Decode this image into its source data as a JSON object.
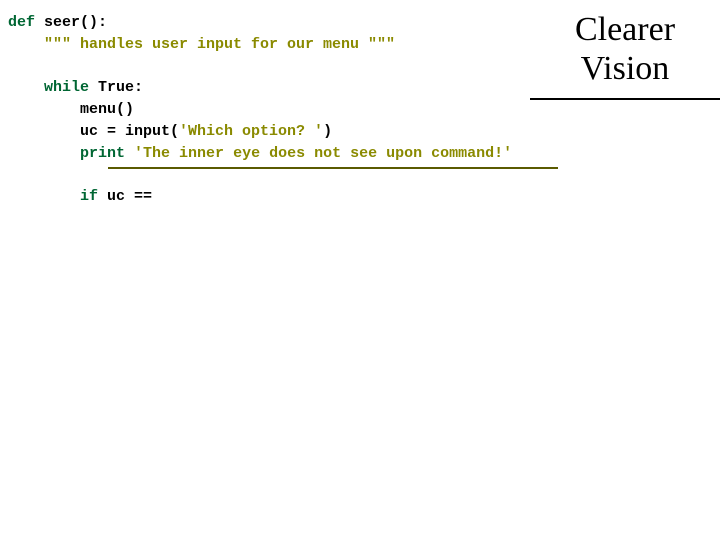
{
  "title": {
    "line1": "Clearer",
    "line2": "Vision"
  },
  "code": {
    "l1_kw": "def",
    "l1_rest": " seer():",
    "l2_doc": "    \"\"\" handles user input for our menu \"\"\"",
    "blank": "",
    "l3_indent": "    ",
    "l3_kw": "while",
    "l3_rest": " True:",
    "l4": "        menu()",
    "l5_a": "        uc = input(",
    "l5_str": "'Which option? '",
    "l5_b": ")",
    "l6_indent": "        ",
    "l6_kw": "print",
    "l6_sp": " ",
    "l6_str": "'The inner eye does not see upon command!'",
    "l7_indent": "        ",
    "l7_kw": "if",
    "l7_rest": " uc =="
  }
}
